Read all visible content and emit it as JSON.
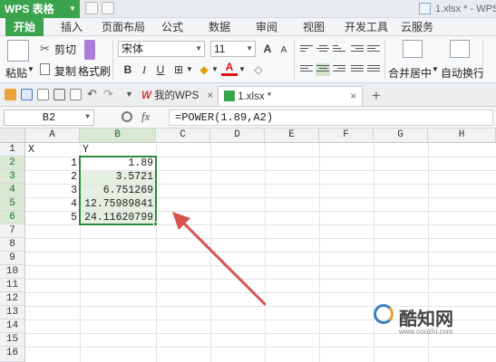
{
  "titlebar": {
    "app_name": "WPS 表格",
    "window_title": "1.xlsx * - WPS"
  },
  "tabs": [
    "开始",
    "插入",
    "页面布局",
    "公式",
    "数据",
    "审阅",
    "视图",
    "开发工具",
    "云服务"
  ],
  "ribbon": {
    "cut": "剪切",
    "copy": "复制",
    "paste": "粘贴",
    "format_painter": "格式刷",
    "font_name": "宋体",
    "font_size": "11",
    "grow_font": "A",
    "shrink_font": "A",
    "bold": "B",
    "italic": "I",
    "underline": "U",
    "font_color_letter": "A",
    "merge_center": "合并居中",
    "wrap_text": "自动换行"
  },
  "docbar": {
    "wps_tab": "我的WPS",
    "file_tab": "1.xlsx *",
    "close": "×",
    "add": "+"
  },
  "formula_bar": {
    "cell_ref": "B2",
    "fx": "fx",
    "formula": "=POWER(1.89,A2)"
  },
  "grid": {
    "columns": [
      "A",
      "B",
      "C",
      "D",
      "E",
      "F",
      "G",
      "H"
    ],
    "rows": [
      "1",
      "2",
      "3",
      "4",
      "5",
      "6",
      "7",
      "8",
      "9",
      "10",
      "11",
      "12",
      "13",
      "14",
      "15",
      "16"
    ],
    "cells": {
      "A1": "X",
      "B1": "Y",
      "A2": "1",
      "A3": "2",
      "A4": "3",
      "A5": "4",
      "A6": "5",
      "B2": "1.89",
      "B3": "3.5721",
      "B4": "6.751269",
      "B5": "12.75989841",
      "B6": "24.11620799"
    }
  },
  "watermark": {
    "brand": "酷知网",
    "url": "www.coozhi.com"
  },
  "colors": {
    "accent": "#3ba34e",
    "selection_border": "#2c8a3c",
    "arrow": "#d9534f"
  }
}
